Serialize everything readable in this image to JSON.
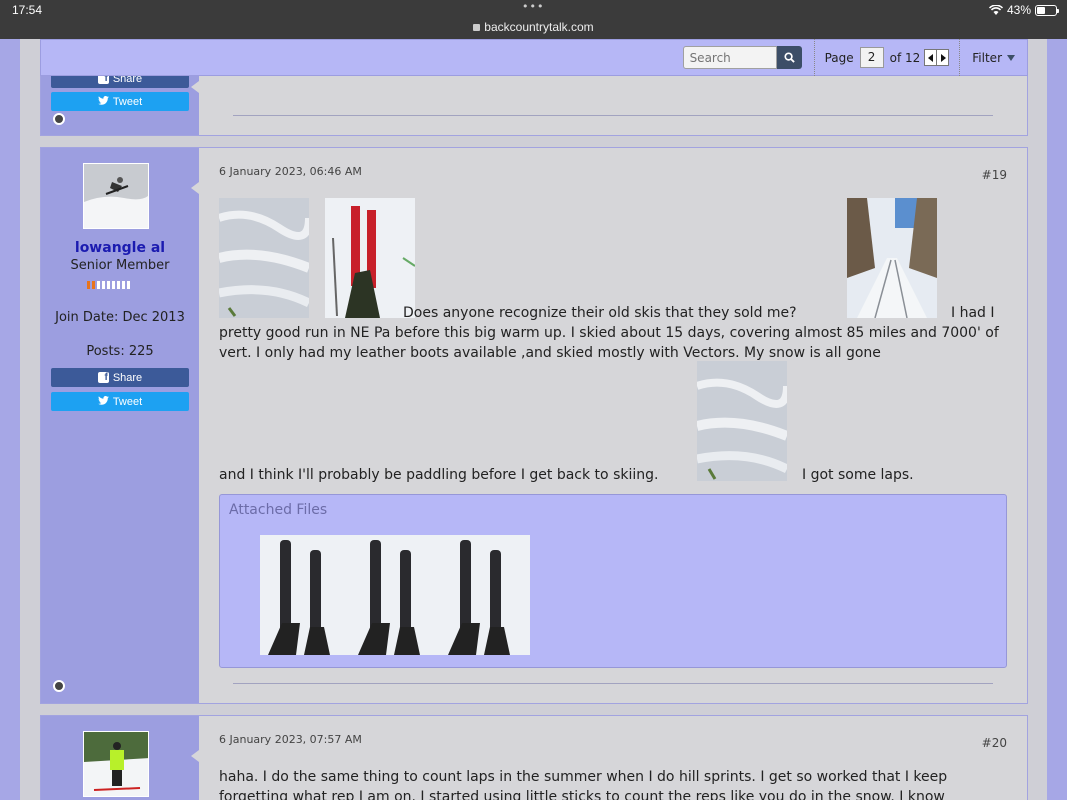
{
  "status_bar": {
    "time": "17:54",
    "dots": "•••",
    "url": "backcountrytalk.com",
    "battery": "43%",
    "battery_level": 0.43
  },
  "toolbar": {
    "search_placeholder": "Search",
    "page_label": "Page",
    "page_current": "2",
    "page_of": "of 12",
    "filter_label": "Filter"
  },
  "share_label": "Share",
  "tweet_label": "Tweet",
  "posts": [
    {
      "date": "6 January 2023, 06:46 AM",
      "number": "#19",
      "username": "lowangle al",
      "user_title": "Senior Member",
      "rank_filled": 2,
      "rank_total": 9,
      "join_date": "Join Date: Dec 2013",
      "posts": "Posts: 225",
      "text_1": "Does anyone recognize their old skis that they sold me?",
      "text_2": "I had I pretty good run in NE Pa before this big warm up. I skied about 15 days, covering almost 85 miles and 7000' of vert. I only had my leather boots available ,and skied mostly with Vectors. My snow is all gone",
      "text_3": "and I think I'll probably be paddling before I get back to skiing.",
      "text_4": "I got some laps.",
      "attached_title": "Attached Files"
    },
    {
      "date": "6 January 2023, 07:57 AM",
      "number": "#20",
      "text_1": "haha. I do the same thing to count laps in the summer when I do hill sprints. I get so worked that I keep forgetting what rep I am on. I started using little sticks to count the reps like you do in the snow. I know"
    }
  ]
}
